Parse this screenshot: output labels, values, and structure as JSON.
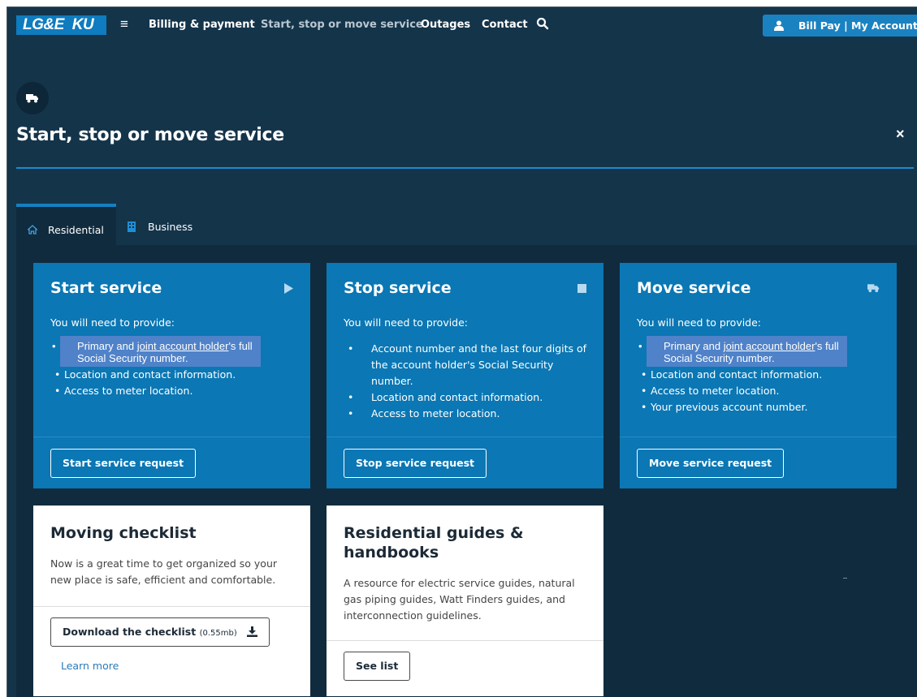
{
  "nav": {
    "logo_left": "LG&E",
    "logo_right": "KU",
    "menu_icon": "hamburger-icon",
    "links": [
      "Billing & payment",
      "Start, stop or move service",
      "Outages",
      "Contact"
    ],
    "search_icon": "search-icon",
    "account_label": "Bill Pay | My Account"
  },
  "header": {
    "icon": "truck-icon",
    "title": "Start, stop or move service",
    "close_label": "×"
  },
  "tabs": [
    {
      "label": "Residential",
      "icon": "home-icon",
      "active": true
    },
    {
      "label": "Business",
      "icon": "building-icon",
      "active": false
    }
  ],
  "cards": [
    {
      "title": "Start service",
      "icon": "play-icon",
      "subtitle": "You will need to provide:",
      "highlight_pre": "Primary and ",
      "highlight_link": "joint account holder",
      "highlight_post": "'s full Social Security number.",
      "items": [
        "Location and contact information.",
        "Access to meter location."
      ],
      "button": "Start service request"
    },
    {
      "title": "Stop service",
      "icon": "stop-icon",
      "subtitle": "You will need to provide:",
      "items": [
        "Account number and the last four digits of the account holder's Social Security number.",
        "Location and contact information.",
        "Access to meter location."
      ],
      "button": "Stop service request"
    },
    {
      "title": "Move service",
      "icon": "truck-icon",
      "subtitle": "You will need to provide:",
      "highlight_pre": "Primary and ",
      "highlight_link": "joint account holder",
      "highlight_post": "'s full Social Security number.",
      "items": [
        "Location and contact information.",
        "Access to meter location.",
        "Your previous account number."
      ],
      "button": "Move service request"
    }
  ],
  "checklist": {
    "title": "Moving checklist",
    "description": "Now is a great time to get organized so your new place is safe, efficient and comfortable.",
    "button": "Download the checklist",
    "button_size": "(0.55mb)",
    "button_icon": "download-icon",
    "link": "Learn more"
  },
  "guides": {
    "title": "Residential guides & handbooks",
    "description": "A resource for electric service guides, natural gas piping guides, Watt Finders guides, and interconnection guidelines.",
    "button": "See list"
  },
  "colors": {
    "background": "#14344a",
    "panel": "#102b3e",
    "card_blue": "#0b77b4",
    "accent": "#1b82c2",
    "highlight": "#4f82c9"
  }
}
